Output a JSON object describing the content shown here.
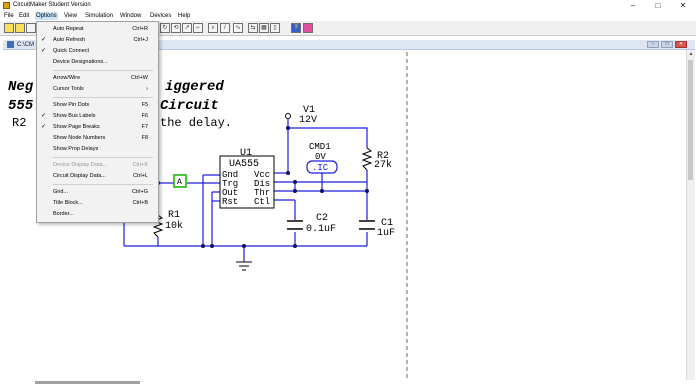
{
  "window": {
    "title": "CircuitMaker Student Version",
    "minimize": "–",
    "maximize": "□",
    "close": "✕"
  },
  "menubar": {
    "items": [
      "File",
      "Edit",
      "Options",
      "View",
      "Simulation",
      "Window",
      "Devices",
      "Help"
    ]
  },
  "toolbar": {
    "buttons": [
      "new-icon",
      "open-icon",
      "save-icon",
      "print-icon",
      "arrow-icon",
      "wire-icon",
      "text-icon",
      "delete-icon",
      "rotate-icon",
      "mirror-icon",
      "probe-icon",
      "zoom-icon",
      "digital-icon",
      "waveform-icon",
      "step-icon",
      "run-icon",
      "stop-icon",
      "help-icon",
      "color-icon"
    ]
  },
  "document": {
    "title": "C:\\CM",
    "min": "–",
    "restore": "□",
    "close": "✕"
  },
  "options_menu": {
    "items": [
      {
        "label": "Auto Repeat",
        "shortcut": "Ctrl+R",
        "checked": false,
        "disabled": false
      },
      {
        "label": "Auto Refresh",
        "shortcut": "Ctrl+J",
        "checked": true,
        "disabled": false
      },
      {
        "label": "Quick Connect",
        "shortcut": "",
        "checked": true,
        "disabled": false
      },
      {
        "label": "Device Designations...",
        "shortcut": "",
        "checked": false,
        "disabled": false
      },
      {
        "label": "Arrow/Wire",
        "shortcut": "Ctrl+W",
        "checked": false,
        "disabled": false
      },
      {
        "label": "Cursor Tools",
        "shortcut": "›",
        "checked": false,
        "disabled": false
      },
      {
        "label": "Show Pin Dots",
        "shortcut": "F5",
        "checked": false,
        "disabled": false
      },
      {
        "label": "Show Bus Labels",
        "shortcut": "F6",
        "checked": true,
        "disabled": false
      },
      {
        "label": "Show Page Breaks",
        "shortcut": "F7",
        "checked": true,
        "disabled": false
      },
      {
        "label": "Show Node Numbers",
        "shortcut": "F8",
        "checked": false,
        "disabled": false
      },
      {
        "label": "Show Prop Delays",
        "shortcut": "",
        "checked": false,
        "disabled": false
      },
      {
        "label": "Device Display Data...",
        "shortcut": "Ctrl+K",
        "checked": false,
        "disabled": true
      },
      {
        "label": "Circuit Display Data...",
        "shortcut": "Ctrl+L",
        "checked": false,
        "disabled": false
      },
      {
        "label": "Grid...",
        "shortcut": "Ctrl+G",
        "checked": false,
        "disabled": false
      },
      {
        "label": "Title Block...",
        "shortcut": "Ctrl+B",
        "checked": false,
        "disabled": false
      },
      {
        "label": "Border...",
        "shortcut": "",
        "checked": false,
        "disabled": false
      }
    ]
  },
  "schematic": {
    "title_line1": "Neg",
    "title_line1b": "iggered",
    "title_line2": "555",
    "title_line2b": "Circuit",
    "subtitle_a": "R2",
    "subtitle_b": "the delay.",
    "v1_name": "V1",
    "v1_value": "12V",
    "cmd1_name": "CMD1",
    "cmd1_value": "0V",
    "cmd1_ic": ".IC",
    "u1_name": "U1",
    "u1_part": "UA555",
    "pins_left": [
      "Gnd",
      "Trg",
      "Out",
      "Rst"
    ],
    "pins_right": [
      "Vcc",
      "Dis",
      "Thr",
      "Ctl"
    ],
    "r1_name": "R1",
    "r1_value": "10k",
    "r2_name": "R2",
    "r2_value": "27k",
    "c1_name": "C1",
    "c1_value": "1uF",
    "c2_name": "C2",
    "c2_value": "0.1uF",
    "node_a": "A"
  },
  "colors": {
    "wire": "#1e1ee0",
    "node": "#101060",
    "schematic_text": "#000000",
    "probe": "#13b000",
    "menu_highlight": "#cce4f7"
  }
}
